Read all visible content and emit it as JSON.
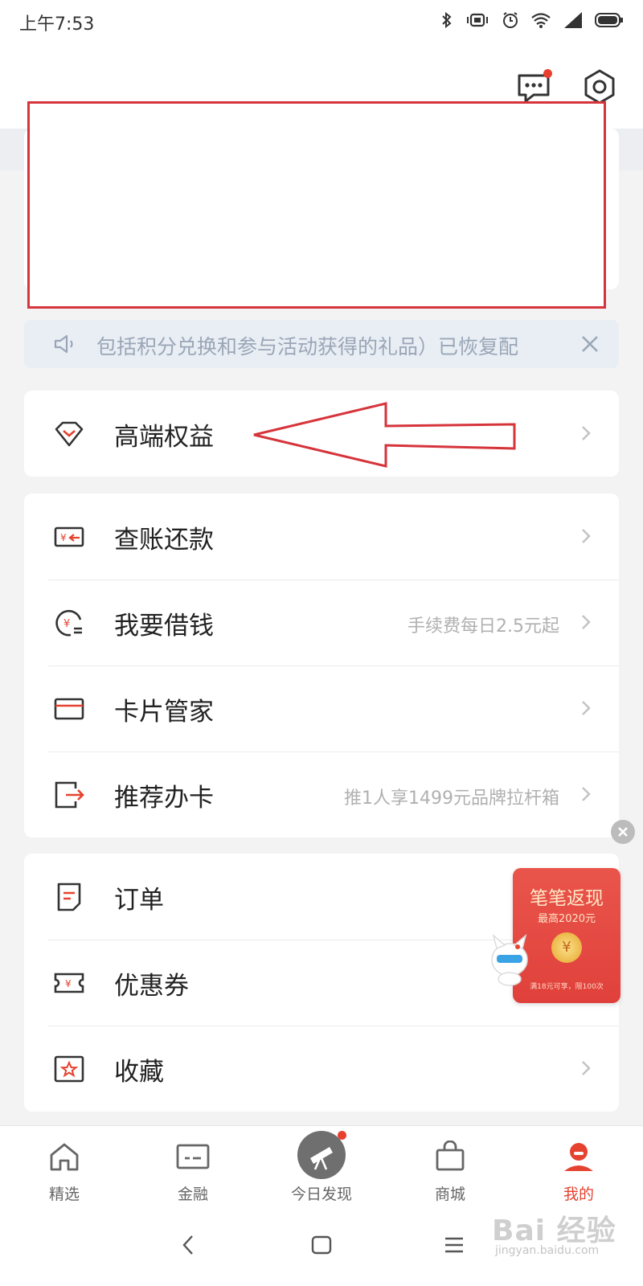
{
  "status_bar": {
    "time": "上午7:53",
    "icons": [
      "bluetooth-icon",
      "vibrate-icon",
      "alarm-icon",
      "wifi-icon",
      "signal-icon",
      "battery-icon"
    ]
  },
  "header": {
    "icons": [
      "message-icon",
      "settings-icon"
    ],
    "message_has_badge": true
  },
  "notice": {
    "text": "包括积分兑换和参与活动获得的礼品）已恢复配",
    "icons": [
      "speaker-icon",
      "close-icon"
    ]
  },
  "menu_groups": [
    [
      {
        "icon": "diamond-icon",
        "label": "高端权益",
        "sub": ""
      }
    ],
    [
      {
        "icon": "bill-icon",
        "label": "查账还款",
        "sub": ""
      },
      {
        "icon": "loan-icon",
        "label": "我要借钱",
        "sub": "手续费每日2.5元起"
      },
      {
        "icon": "card-icon",
        "label": "卡片管家",
        "sub": ""
      },
      {
        "icon": "recommend-icon",
        "label": "推荐办卡",
        "sub": "推1人享1499元品牌拉杆箱"
      }
    ],
    [
      {
        "icon": "order-icon",
        "label": "订单",
        "sub": ""
      },
      {
        "icon": "coupon-icon",
        "label": "优惠券",
        "sub": ""
      },
      {
        "icon": "favorite-icon",
        "label": "收藏",
        "sub": ""
      }
    ]
  ],
  "promo": {
    "title": "笔笔返现",
    "subtitle": "最高2020元",
    "coin": "¥",
    "note": "满18元可享，限100次"
  },
  "tabs": [
    {
      "label": "精选",
      "icon": "home-icon",
      "active": false
    },
    {
      "label": "金融",
      "icon": "finance-icon",
      "active": false
    },
    {
      "label": "今日发现",
      "icon": "telescope-icon",
      "active": false
    },
    {
      "label": "商城",
      "icon": "bag-icon",
      "active": false
    },
    {
      "label": "我的",
      "icon": "profile-icon",
      "active": true
    }
  ],
  "system_nav": [
    "back-icon",
    "home-square-icon",
    "menu-icon"
  ],
  "watermark": {
    "top": "Bai 经验",
    "bottom": "jingyan.baidu.com"
  },
  "colors": {
    "accent": "#e5432f",
    "highlight": "#d6343b",
    "notice_bg": "#e9eef5",
    "page_bg": "#f3f3f4"
  }
}
